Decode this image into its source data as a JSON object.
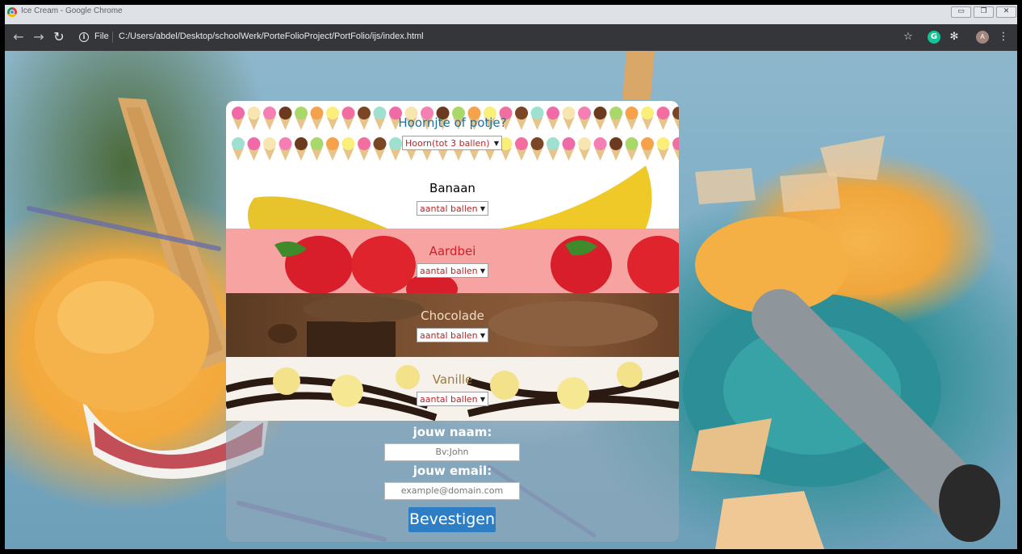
{
  "browser": {
    "window_title": "Ice Cream - Google Chrome",
    "url_scheme_label": "File",
    "url_path": "C:/Users/abdel/Desktop/schoolWerk/PorteFolioProject/PortFolio/ijs/index.html",
    "avatar_initial": "A"
  },
  "cone": {
    "title": "Hoornjte of potje?",
    "select_value": "Hoorn(tot 3 ballen)"
  },
  "flavors": [
    {
      "name": "Banaan",
      "select_value": "aantal ballen",
      "title_color": "#4a3a28"
    },
    {
      "name": "Aardbei",
      "select_value": "aantal ballen",
      "title_color": "#c8222a"
    },
    {
      "name": "Chocolade",
      "select_value": "aantal ballen",
      "title_color": "#f4dcc0"
    },
    {
      "name": "Vanille",
      "select_value": "aantal ballen",
      "title_color": "#9a7a40"
    }
  ],
  "form": {
    "name_label": "jouw naam:",
    "name_placeholder": "Bv:John",
    "email_label": "jouw email:",
    "email_placeholder": "example@domain.com",
    "submit_label": "Bevestigen"
  },
  "colors": {
    "cone_title": "#1f6f9e",
    "submit_bg": "#2e7ec6",
    "select_text": "#b3262a"
  }
}
